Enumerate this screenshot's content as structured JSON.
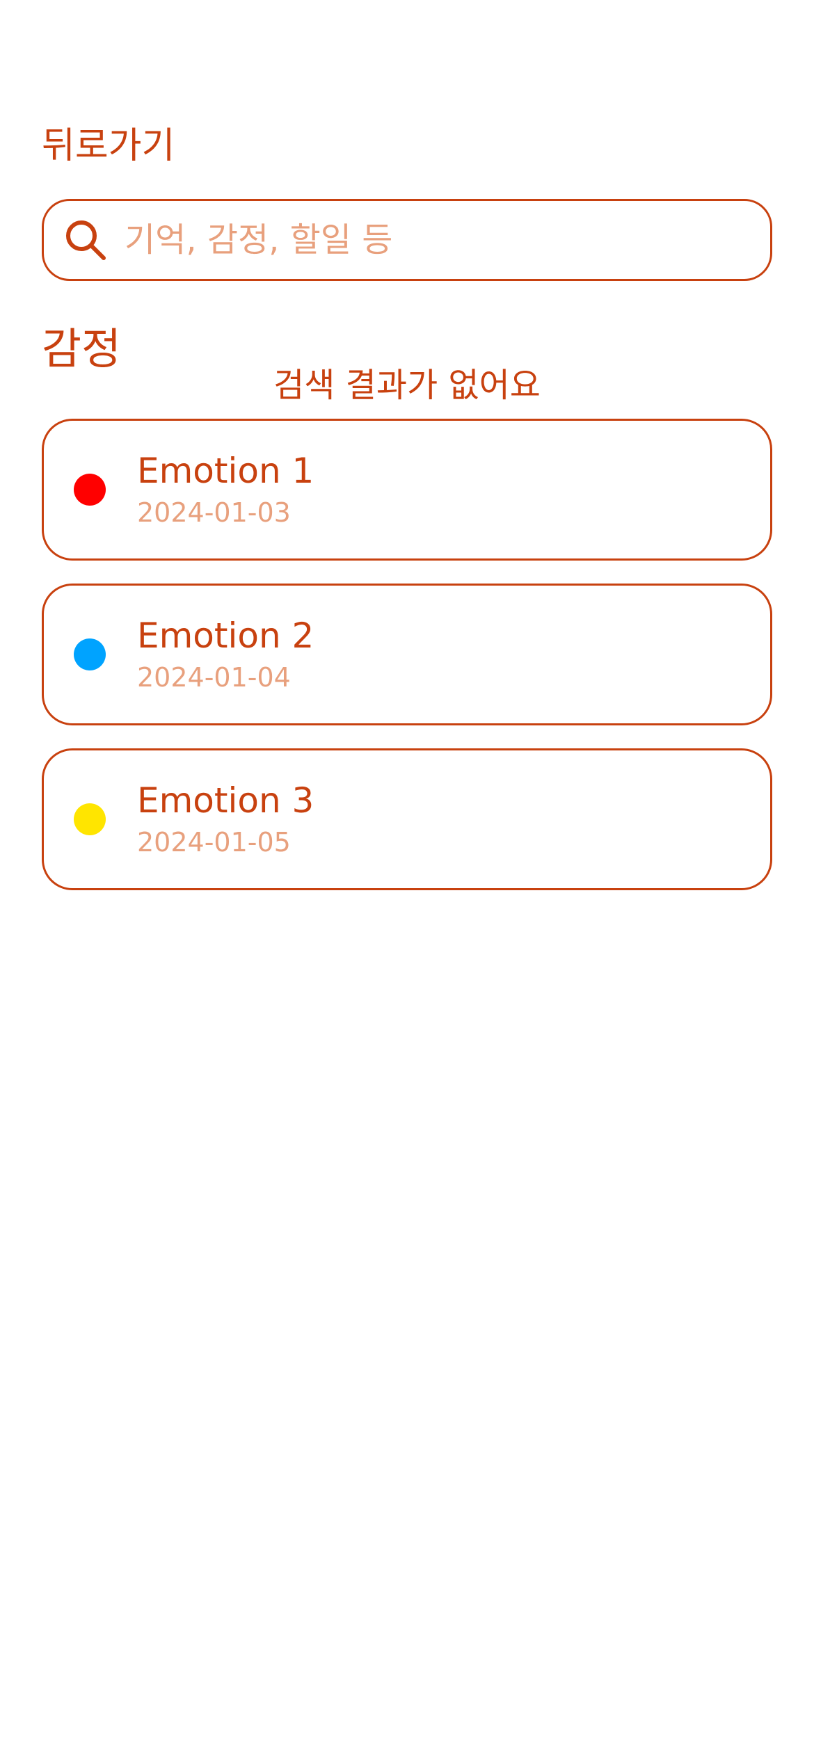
{
  "header": {
    "back_label": "뒤로가기"
  },
  "search": {
    "placeholder": "기억, 감정, 할일 등",
    "value": ""
  },
  "section": {
    "title": "감정",
    "empty_message": "검색 결과가 없어요"
  },
  "items": [
    {
      "name": "Emotion 1",
      "date": "2024-01-03",
      "color": "#FF0000"
    },
    {
      "name": "Emotion 2",
      "date": "2024-01-04",
      "color": "#00A3FF"
    },
    {
      "name": "Emotion 3",
      "date": "2024-01-05",
      "color": "#FFE500"
    }
  ],
  "colors": {
    "accent": "#C8410F",
    "muted": "#E8A07D",
    "background": "#FFFFFF"
  },
  "icons": {
    "search": "search-icon"
  }
}
